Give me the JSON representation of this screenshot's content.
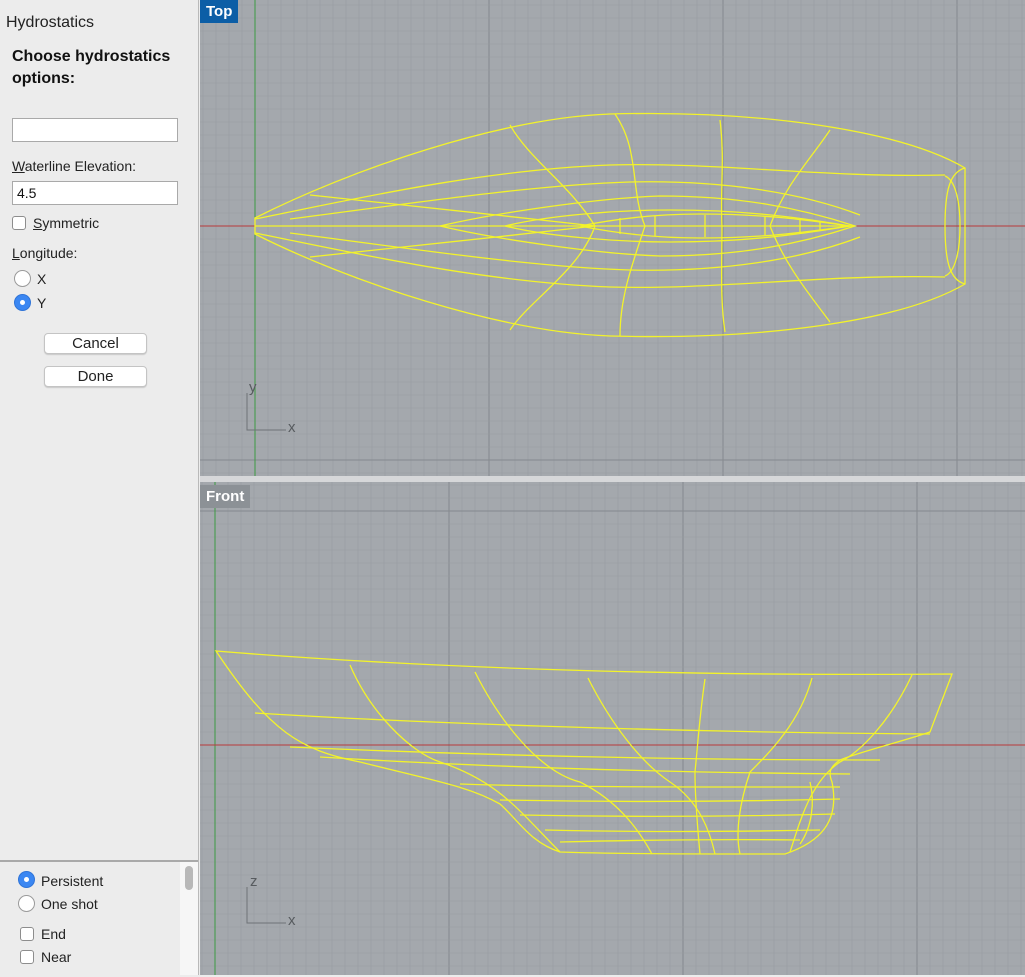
{
  "panel": {
    "title": "Hydrostatics",
    "heading": "Choose hydrostatics options:",
    "prompt_value": "",
    "waterline": {
      "label_first": "W",
      "label_rest": "aterline Elevation:",
      "value": "4.5"
    },
    "symmetric": {
      "label_first": "S",
      "label_rest": "ymmetric",
      "checked": false
    },
    "longitude": {
      "label_first": "L",
      "label_rest": "ongitude:",
      "options": [
        "X",
        "Y"
      ],
      "selected": "Y"
    },
    "cancel_label": "Cancel",
    "done_label": "Done"
  },
  "snap_panel": {
    "mode_options": [
      "Persistent",
      "One shot"
    ],
    "mode_selected": "Persistent",
    "osnaps": [
      {
        "label": "End",
        "checked": false
      },
      {
        "label": "Near",
        "checked": false
      }
    ]
  },
  "viewports": {
    "top": {
      "name": "Top",
      "axis_1": "y",
      "axis_2": "x"
    },
    "front": {
      "name": "Front",
      "axis_1": "z",
      "axis_2": "x"
    }
  },
  "colors": {
    "viewport_bg": "#a4a8ad",
    "grid_minor": "#979ca1",
    "grid_major": "#85898e",
    "x_axis": "#b83a3a",
    "y_axis": "#3d9a42",
    "curve": "#f3f32a",
    "active_label": "#0c5ea6",
    "radio_selected": "#3b87f2"
  },
  "icons": [
    "radio-selected-icon",
    "radio-unselected-icon",
    "checkbox-icon",
    "axis-widget-icon"
  ]
}
